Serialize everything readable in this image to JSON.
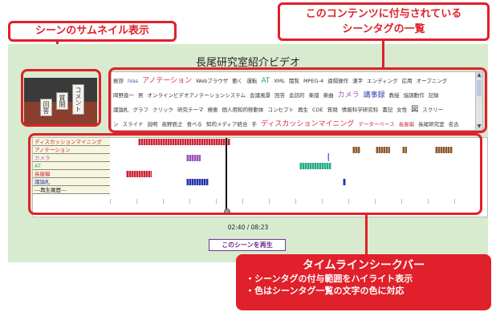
{
  "video": {
    "title": "長尾研究室紹介ビデオ",
    "time": "02:40 / 08:23",
    "play_scene_label": "このシーンを再生",
    "thumbnail_cards": [
      "回答",
      "質問",
      "コメント"
    ]
  },
  "tags": {
    "lines": [
      [
        {
          "t": "挨拶",
          "c": "#333333"
        },
        {
          "t": "iVas",
          "c": "#3355aa"
        },
        {
          "t": "アノテーション",
          "c": "#cc3344",
          "big": true
        },
        {
          "t": "Webブラウザ",
          "c": "#333333"
        },
        {
          "t": "動く",
          "c": "#333333"
        },
        {
          "t": "運転",
          "c": "#333333"
        },
        {
          "t": "AT",
          "c": "#22aa55",
          "big": true
        },
        {
          "t": "XML",
          "c": "#333333"
        },
        {
          "t": "閲覧",
          "c": "#333333"
        },
        {
          "t": "MPEG-4",
          "c": "#333333"
        },
        {
          "t": "遠隔操作",
          "c": "#333333"
        },
        {
          "t": "漢字",
          "c": "#333333"
        },
        {
          "t": "エンディング",
          "c": "#333333"
        },
        {
          "t": "応用",
          "c": "#333333"
        },
        {
          "t": "オープニング",
          "c": "#333333"
        }
      ],
      [
        {
          "t": "岡野直一",
          "c": "#333333"
        },
        {
          "t": "男",
          "c": "#333333"
        },
        {
          "t": "オンラインビデオアノテーションシステム",
          "c": "#333333"
        },
        {
          "t": "会議風景",
          "c": "#333333"
        },
        {
          "t": "回答",
          "c": "#333333"
        },
        {
          "t": "会話的",
          "c": "#333333"
        },
        {
          "t": "楽譜",
          "c": "#333333"
        },
        {
          "t": "楽曲",
          "c": "#333333"
        },
        {
          "t": "カメラ",
          "c": "#9955bb",
          "big": true
        },
        {
          "t": "講事録",
          "c": "#3344aa",
          "big": true
        },
        {
          "t": "教授",
          "c": "#333333"
        },
        {
          "t": "協調動作",
          "c": "#333333"
        },
        {
          "t": "記録",
          "c": "#333333"
        }
      ],
      [
        {
          "t": "議論札",
          "c": "#333333"
        },
        {
          "t": "グラフ",
          "c": "#333333"
        },
        {
          "t": "クリック",
          "c": "#333333"
        },
        {
          "t": "研究テーマ",
          "c": "#333333"
        },
        {
          "t": "検索",
          "c": "#333333"
        },
        {
          "t": "個人用知的移動体",
          "c": "#333333"
        },
        {
          "t": "コンセプト",
          "c": "#333333"
        },
        {
          "t": "再生",
          "c": "#333333"
        },
        {
          "t": "COE",
          "c": "#333333"
        },
        {
          "t": "質問",
          "c": "#333333"
        },
        {
          "t": "情報科学研究科",
          "c": "#333333"
        },
        {
          "t": "書記",
          "c": "#333333"
        },
        {
          "t": "女性",
          "c": "#333333"
        },
        {
          "t": "図",
          "c": "#333333",
          "big": true
        },
        {
          "t": "スクリー",
          "c": "#333333"
        }
      ],
      [
        {
          "t": "ン",
          "c": "#333333"
        },
        {
          "t": "スライド",
          "c": "#333333"
        },
        {
          "t": "説明",
          "c": "#333333"
        },
        {
          "t": "高野辰之",
          "c": "#333333"
        },
        {
          "t": "食べる",
          "c": "#333333"
        },
        {
          "t": "知的メディア統合",
          "c": "#333333"
        },
        {
          "t": "手",
          "c": "#333333"
        },
        {
          "t": "ディスカッションマイニング",
          "c": "#cc3344",
          "big": true
        },
        {
          "t": "データーベース",
          "c": "#cc3344"
        },
        {
          "t": "長屋編",
          "c": "#cc3344"
        },
        {
          "t": "長尾研究室",
          "c": "#333333"
        },
        {
          "t": "名古",
          "c": "#333333"
        }
      ]
    ]
  },
  "timeline": {
    "tracks": [
      {
        "label": "ディスカッションマイニング",
        "color": "#cc2233"
      },
      {
        "label": "アノテーション",
        "color": "#cc2233"
      },
      {
        "label": "カメラ",
        "color": "#9955bb"
      },
      {
        "label": "AT",
        "color": "#22aa55"
      },
      {
        "label": "長屋編",
        "color": "#cc2233"
      },
      {
        "label": "議論札",
        "color": "#2233aa"
      },
      {
        "label": "---再生履歴---",
        "color": "#222222"
      }
    ],
    "track_colors": [
      "#cc2233",
      "#8b5a2b",
      "#9955bb",
      "#22aa88",
      "#cc2233",
      "#2233aa"
    ]
  },
  "callouts": {
    "thumbnail_label": "シーンのサムネイル表示",
    "tag_list_label_1": "このコンテンツに付与されている",
    "tag_list_label_2": "シーンタグの一覧",
    "seek_title": "タイムラインシークバー",
    "seek_bullet_1": "・シーンタグの付与範囲をハイライト表示",
    "seek_bullet_2": "・色はシーンタグ一覧の文字の色に対応"
  }
}
